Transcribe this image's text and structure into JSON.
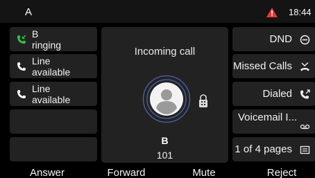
{
  "status_bar": {
    "account": "A",
    "time": "18:44",
    "alert_icon": "warning-triangle-icon",
    "alert_color": "#e53935"
  },
  "line_keys": [
    {
      "label_line1": "B",
      "label_line2": "ringing",
      "icon": "incoming-call-icon",
      "icon_color": "#33c24d"
    },
    {
      "label_line1": "Line",
      "label_line2": "available",
      "icon": "phone-icon",
      "icon_color": "#ffffff"
    },
    {
      "label_line1": "Line",
      "label_line2": "available",
      "icon": "phone-icon",
      "icon_color": "#ffffff"
    },
    {
      "label_line1": "",
      "label_line2": ""
    },
    {
      "label_line1": "",
      "label_line2": ""
    }
  ],
  "function_keys": [
    {
      "label": "DND",
      "icon": "dnd-icon"
    },
    {
      "label": "Missed Calls",
      "icon": "missed-calls-icon"
    },
    {
      "label": "Dialed",
      "icon": "dialed-calls-icon"
    },
    {
      "label": "Voicemail I...",
      "icon": "voicemail-icon"
    },
    {
      "label": "1 of 4 pages",
      "icon": "pages-icon"
    }
  ],
  "call": {
    "title": "Incoming call",
    "caller_name": "B",
    "caller_number": "101",
    "ring_color": "#4a5a9a"
  },
  "softkeys": [
    "Answer",
    "Forward",
    "Mute",
    "Reject"
  ]
}
